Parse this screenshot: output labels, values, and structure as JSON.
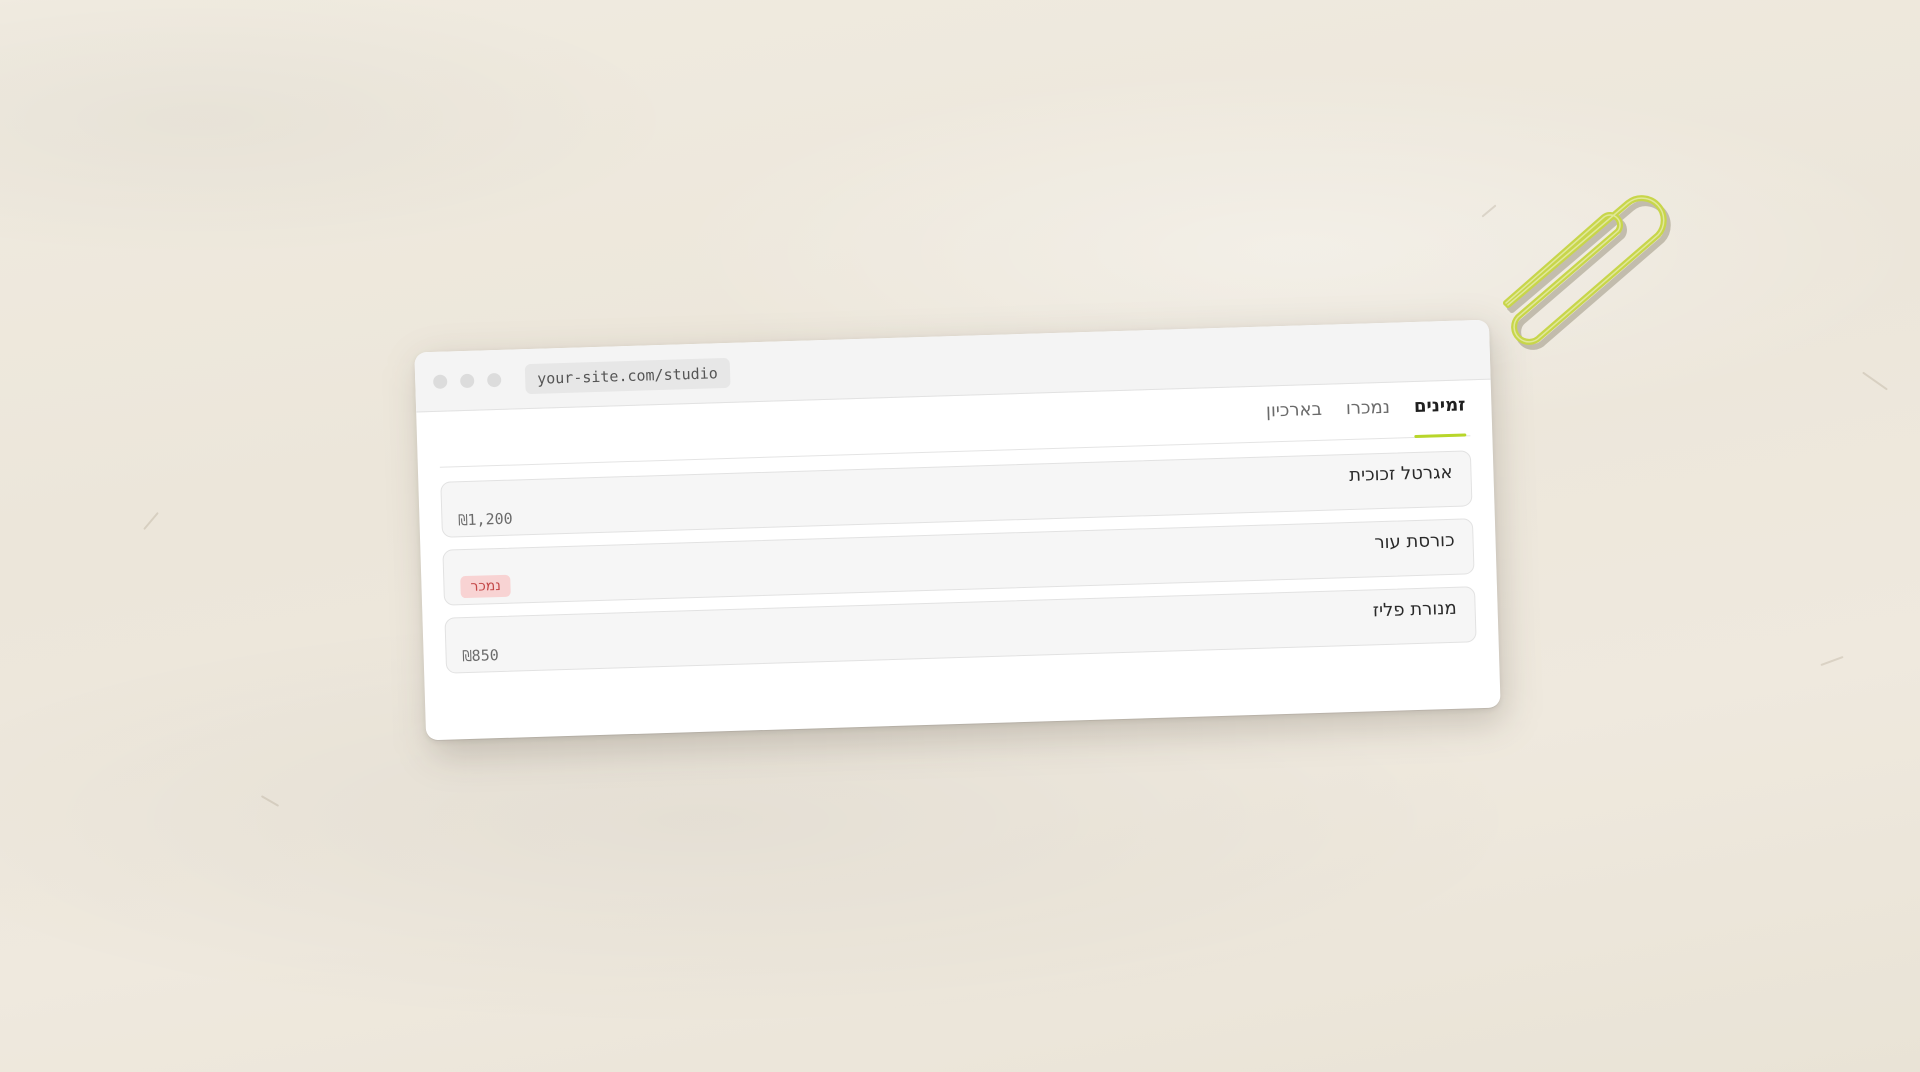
{
  "browser": {
    "url": "your-site.com/studio"
  },
  "tabs": [
    {
      "label": "זמינים",
      "active": true
    },
    {
      "label": "נמכרו",
      "active": false
    },
    {
      "label": "בארכיון",
      "active": false
    }
  ],
  "items": [
    {
      "name": "אגרטל זכוכית",
      "price": "₪1,200"
    },
    {
      "name": "כורסת עור",
      "badge": "נמכר"
    },
    {
      "name": "מנורת פליז",
      "price": "₪850"
    }
  ],
  "colors": {
    "accent": "#b8d62a",
    "sold_badge_bg": "#f8d3d3",
    "sold_badge_text": "#c44848",
    "paperclip": "#c8d64a"
  }
}
